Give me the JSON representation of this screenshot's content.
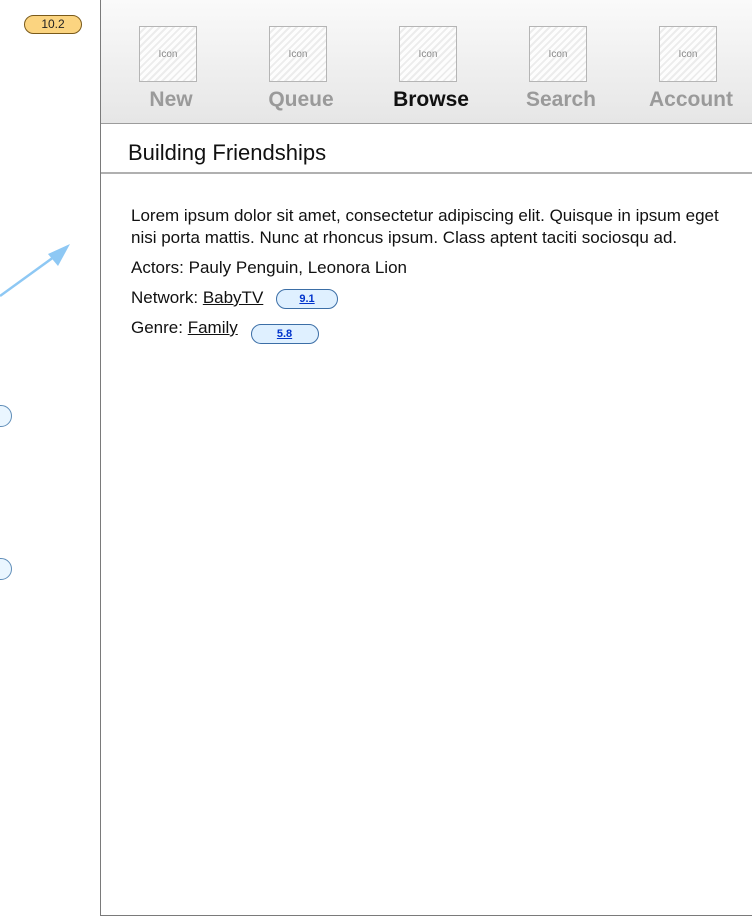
{
  "annotations": {
    "main_callout": "10.2",
    "network_badge": "9.1",
    "genre_badge": "5.8"
  },
  "tabs": [
    {
      "icon_label": "Icon",
      "label": "New",
      "active": false
    },
    {
      "icon_label": "Icon",
      "label": "Queue",
      "active": false
    },
    {
      "icon_label": "Icon",
      "label": "Browse",
      "active": true
    },
    {
      "icon_label": "Icon",
      "label": "Search",
      "active": false
    },
    {
      "icon_label": "Icon",
      "label": "Account",
      "active": false
    }
  ],
  "page": {
    "title": "Building Friendships",
    "description": "Lorem ipsum dolor sit amet, consectetur adipiscing elit. Quisque in ipsum eget nisi porta mattis. Nunc at rhoncus ipsum. Class aptent taciti sociosqu ad.",
    "actors_label": "Actors:",
    "actors_value": "Pauly Penguin, Leonora Lion",
    "network_label": "Network:",
    "network_link": "BabyTV",
    "genre_label": "Genre:",
    "genre_link": "Family"
  },
  "colors": {
    "callout": "#fbd480",
    "link_badge": "#dff0ff",
    "arrow": "#8ec8f4"
  }
}
